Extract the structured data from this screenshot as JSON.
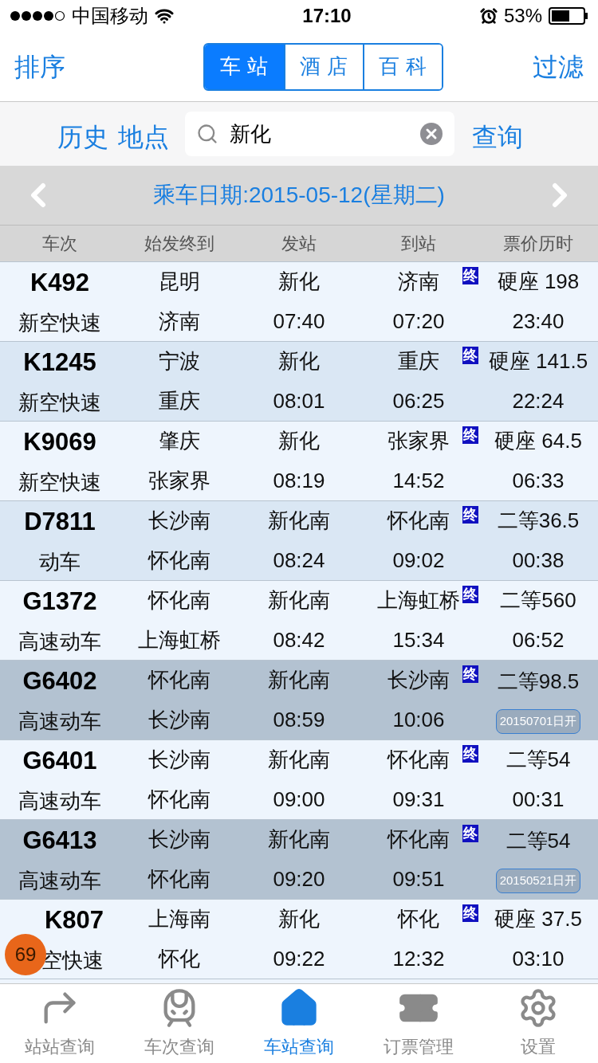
{
  "status_bar": {
    "carrier": "中国移动",
    "time": "17:10",
    "battery": "53%"
  },
  "nav": {
    "left": "排序",
    "right": "过滤",
    "segments": [
      {
        "label": "车 站",
        "selected": true
      },
      {
        "label": "酒 店",
        "selected": false
      },
      {
        "label": "百 科",
        "selected": false
      }
    ]
  },
  "search": {
    "history": "历史",
    "place": "地点",
    "value": "新化",
    "submit": "查询"
  },
  "date_bar": {
    "label": "乘车日期:2015-05-12(星期二)"
  },
  "table": {
    "columns": [
      "车次",
      "始发终到",
      "发站",
      "到站",
      "票价历时"
    ],
    "rows": [
      {
        "kind": "normal",
        "train": "K492",
        "type": "新空快速",
        "origin": "昆明",
        "terminus": "济南",
        "from": "新化",
        "depart": "07:40",
        "to": "济南",
        "arrive": "07:20",
        "mark": "终",
        "price": "硬座 198",
        "duration": "23:40"
      },
      {
        "kind": "normal",
        "train": "K1245",
        "type": "新空快速",
        "origin": "宁波",
        "terminus": "重庆",
        "from": "新化",
        "depart": "08:01",
        "to": "重庆",
        "arrive": "06:25",
        "mark": "终",
        "price": "硬座 141.5",
        "duration": "22:24"
      },
      {
        "kind": "normal",
        "train": "K9069",
        "type": "新空快速",
        "origin": "肇庆",
        "terminus": "张家界",
        "from": "新化",
        "depart": "08:19",
        "to": "张家界",
        "arrive": "14:52",
        "mark": "终",
        "price": "硬座 64.5",
        "duration": "06:33"
      },
      {
        "kind": "normal",
        "train": "D7811",
        "type": "动车",
        "origin": "长沙南",
        "terminus": "怀化南",
        "from": "新化南",
        "depart": "08:24",
        "to": "怀化南",
        "arrive": "09:02",
        "mark": "终",
        "price": "二等36.5",
        "duration": "00:38"
      },
      {
        "kind": "normal",
        "train": "G1372",
        "type": "高速动车",
        "origin": "怀化南",
        "terminus": "上海虹桥",
        "from": "新化南",
        "depart": "08:42",
        "to": "上海虹桥",
        "arrive": "15:34",
        "mark": "终",
        "price": "二等560",
        "duration": "06:52"
      },
      {
        "kind": "not_open",
        "train": "G6402",
        "type": "高速动车",
        "origin": "怀化南",
        "terminus": "长沙南",
        "from": "新化南",
        "depart": "08:59",
        "to": "长沙南",
        "arrive": "10:06",
        "mark": "终",
        "price": "二等98.5",
        "duration": "20150701日开"
      },
      {
        "kind": "normal",
        "train": "G6401",
        "type": "高速动车",
        "origin": "长沙南",
        "terminus": "怀化南",
        "from": "新化南",
        "depart": "09:00",
        "to": "怀化南",
        "arrive": "09:31",
        "mark": "终",
        "price": "二等54",
        "duration": "00:31"
      },
      {
        "kind": "not_open",
        "train": "G6413",
        "type": "高速动车",
        "origin": "长沙南",
        "terminus": "怀化南",
        "from": "新化南",
        "depart": "09:20",
        "to": "怀化南",
        "arrive": "09:51",
        "mark": "终",
        "price": "二等54",
        "duration": "20150521日开"
      },
      {
        "kind": "normal",
        "train": "K807",
        "type": "空快速",
        "origin": "上海南",
        "terminus": "怀化",
        "from": "新化",
        "depart": "09:22",
        "to": "怀化",
        "arrive": "12:32",
        "mark": "终",
        "price": "硬座 37.5",
        "duration": "03:10"
      }
    ]
  },
  "floating_badge": "69",
  "tab_bar": [
    {
      "kind": "share",
      "label": "站站查询",
      "selected": false
    },
    {
      "kind": "train",
      "label": "车次查询",
      "selected": false
    },
    {
      "kind": "home",
      "label": "车站查询",
      "selected": true
    },
    {
      "kind": "ticket",
      "label": "订票管理",
      "selected": false
    },
    {
      "kind": "settings",
      "label": "设置",
      "selected": false
    }
  ]
}
